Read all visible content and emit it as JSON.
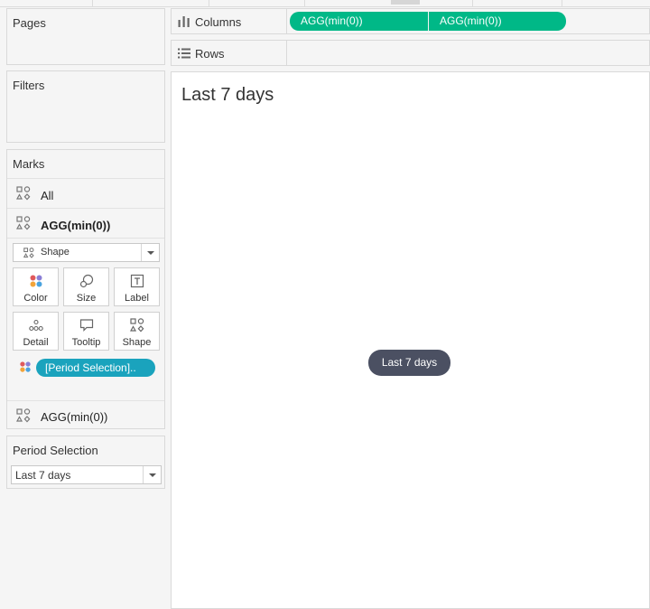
{
  "pages": {
    "title": "Pages"
  },
  "filters": {
    "title": "Filters"
  },
  "marks": {
    "title": "Marks",
    "all_label": "All",
    "layer1_label": "AGG(min(0))",
    "mark_type": "Shape",
    "buttons": {
      "color": "Color",
      "size": "Size",
      "label": "Label",
      "detail": "Detail",
      "tooltip": "Tooltip",
      "shape": "Shape"
    },
    "color_pill": "[Period Selection]..",
    "layer2_label": "AGG(min(0))"
  },
  "parameter": {
    "title": "Period Selection",
    "value": "Last 7 days"
  },
  "shelves": {
    "columns_label": "Columns",
    "columns_pills": [
      "AGG(min(0))",
      "AGG(min(0))"
    ],
    "rows_label": "Rows"
  },
  "viz": {
    "title": "Last 7 days",
    "mark_text": "Last 7 days"
  },
  "colors": {
    "column_pill": "#00b887",
    "color_pill": "#1aa3bd",
    "mark": "#4b5062"
  },
  "icons": {
    "columns": "columns-icon",
    "rows": "rows-icon",
    "shape": "shape-marks-icon",
    "color": "color-dots-icon",
    "size": "size-circles-icon",
    "label": "label-T-icon",
    "detail": "detail-dots-icon",
    "tooltip": "tooltip-bubble-icon",
    "dropdown": "chevron-down-icon"
  }
}
